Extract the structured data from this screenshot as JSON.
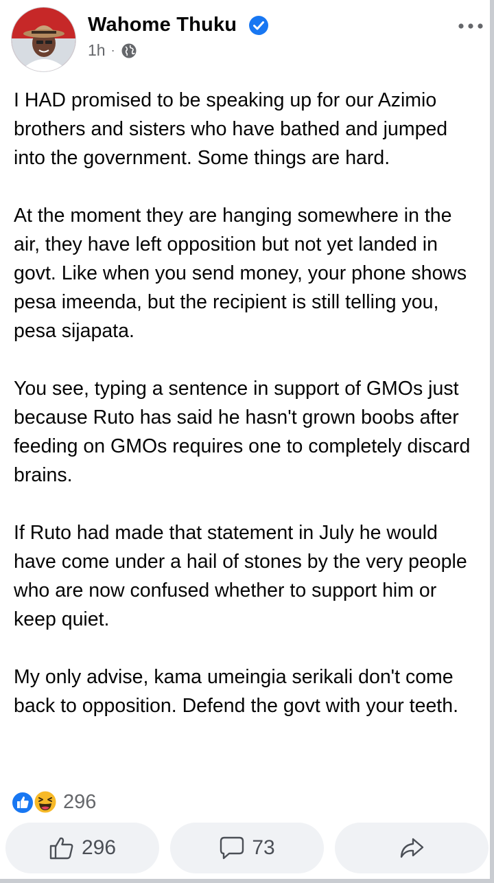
{
  "post": {
    "author": "Wahome Thuku",
    "time": "1h",
    "separator": "·",
    "paragraphs": [
      "I HAD promised to be speaking up for our Azimio brothers and sisters who have bathed and jumped into the government. Some things are hard.",
      "At the moment they are hanging somewhere in the air, they have left opposition but not yet landed in govt. Like when you send money, your phone shows pesa imeenda, but the recipient is still telling you, pesa sijapata.",
      "You see, typing a sentence in support of GMOs just because Ruto has said he hasn't grown boobs after feeding on GMOs requires one to completely discard brains.",
      "If Ruto had made that statement in July he would have come under a hail of stones by the very people who are now confused whether to support him or keep quiet.",
      "My only advise, kama umeingia serikali don't come back to opposition. Defend the govt with your teeth."
    ]
  },
  "reactions": {
    "count": "296",
    "types": [
      "like-icon",
      "haha-icon"
    ]
  },
  "actions": {
    "like_count": "296",
    "comment_count": "73"
  },
  "icons": {
    "verified": "verified-badge-icon",
    "privacy": "globe-icon",
    "more": "more-options-icon",
    "like": "thumbs-up-icon",
    "comment": "comment-bubble-icon",
    "share": "share-arrow-icon"
  },
  "colors": {
    "verified_blue": "#1877f2",
    "like_blue": "#1877f2",
    "haha_yellow": "#f7b928",
    "secondary_text": "#65676b",
    "button_bg": "#f0f2f5"
  }
}
